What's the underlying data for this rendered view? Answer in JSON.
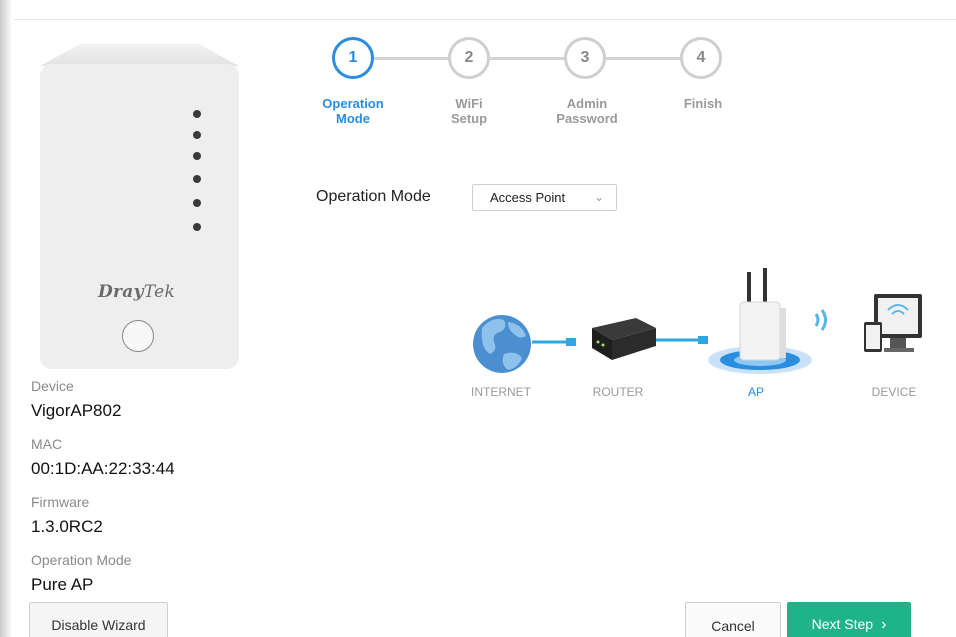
{
  "device_panel": {
    "brand_left": "Dray",
    "brand_right": "Tek",
    "device_label": "Device",
    "device_value": "VigorAP802",
    "mac_label": "MAC",
    "mac_value": "00:1D:AA:22:33:44",
    "firmware_label": "Firmware",
    "firmware_value": "1.3.0RC2",
    "opmode_label": "Operation Mode",
    "opmode_value": "Pure AP"
  },
  "steps": [
    {
      "number": "1",
      "label_line1": "Operation",
      "label_line2": "Mode",
      "active": true
    },
    {
      "number": "2",
      "label_line1": "WiFi",
      "label_line2": "Setup",
      "active": false
    },
    {
      "number": "3",
      "label_line1": "Admin",
      "label_line2": "Password",
      "active": false
    },
    {
      "number": "4",
      "label_line1": "Finish",
      "label_line2": "",
      "active": false
    }
  ],
  "form": {
    "operation_mode_label": "Operation Mode",
    "operation_mode_selected": "Access Point"
  },
  "diagram": {
    "internet_label": "INTERNET",
    "router_label": "ROUTER",
    "ap_label": "AP",
    "device_label": "DEVICE"
  },
  "buttons": {
    "disable_wizard": "Disable Wizard",
    "cancel": "Cancel",
    "next_step": "Next Step"
  },
  "colors": {
    "accent": "#2a8de0",
    "next_button": "#1fb38a",
    "cable": "#2aa8e0"
  },
  "icons": {
    "select_chevron": "chevron-down-icon",
    "next_arrow": "chevron-right-icon"
  }
}
